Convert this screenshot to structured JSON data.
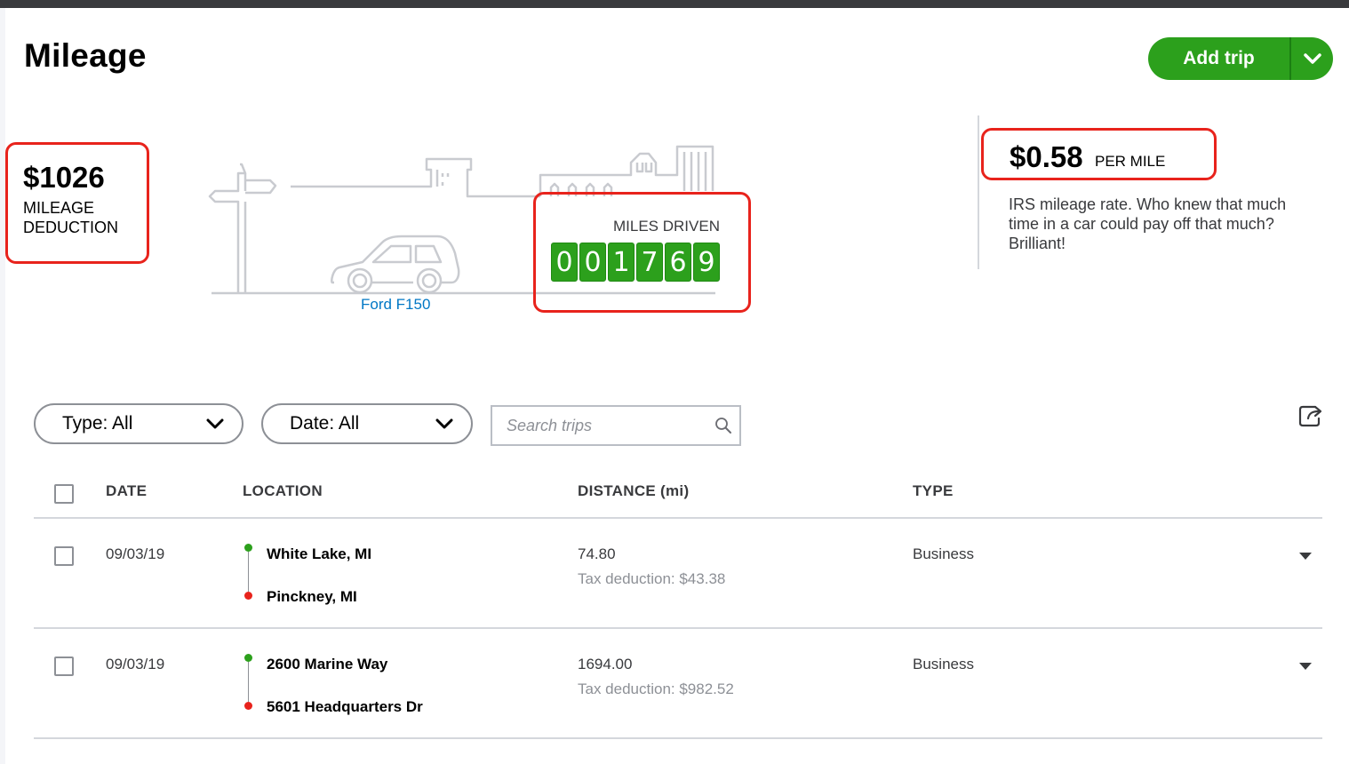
{
  "page": {
    "title": "Mileage"
  },
  "header": {
    "add_trip_label": "Add trip"
  },
  "summary": {
    "deduction_amount": "$1026",
    "deduction_label": "MILEAGE DEDUCTION",
    "vehicle": "Ford F150",
    "miles_driven_label": "MILES DRIVEN",
    "odometer_digits": [
      "0",
      "0",
      "1",
      "7",
      "6",
      "9"
    ],
    "rate_amount": "$0.58",
    "rate_unit": "PER MILE",
    "rate_description": "IRS mileage rate. Who knew that much time in a car could pay off that much? Brilliant!"
  },
  "filters": {
    "type_label": "Type: All",
    "date_label": "Date: All",
    "search_placeholder": "Search trips"
  },
  "table": {
    "headers": {
      "date": "DATE",
      "location": "LOCATION",
      "distance": "DISTANCE (mi)",
      "type": "TYPE"
    },
    "rows": [
      {
        "date": "09/03/19",
        "from": "White Lake, MI",
        "to": "Pinckney, MI",
        "distance": "74.80",
        "deduction": "Tax deduction: $43.38",
        "type": "Business"
      },
      {
        "date": "09/03/19",
        "from": "2600 Marine Way",
        "to": "5601 Headquarters Dr",
        "distance": "1694.00",
        "deduction": "Tax deduction: $982.52",
        "type": "Business"
      }
    ]
  },
  "colors": {
    "accent_green": "#2ca01c",
    "highlight_red": "#e8231c",
    "link_blue": "#0077c5",
    "start_dot": "#2ca01c",
    "end_dot": "#e8231c"
  }
}
